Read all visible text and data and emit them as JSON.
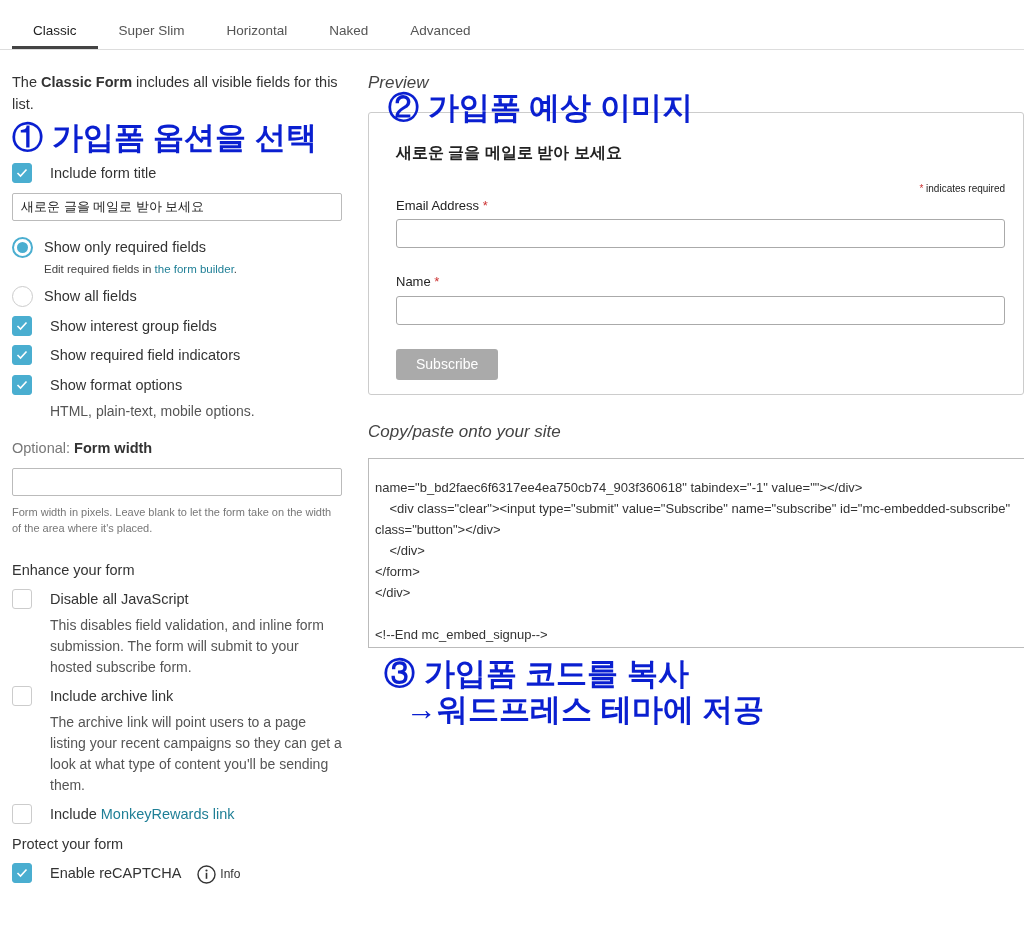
{
  "tabs": [
    {
      "label": "Classic",
      "selected": true
    },
    {
      "label": "Super Slim",
      "selected": false
    },
    {
      "label": "Horizontal",
      "selected": false
    },
    {
      "label": "Naked",
      "selected": false
    },
    {
      "label": "Advanced",
      "selected": false
    }
  ],
  "options": {
    "intro": "The **Classic Form** includes all visible fields for this list.",
    "annotation": "① 가입폼 옵션을 선택",
    "items": [
      {
        "kind": "checkbox",
        "label": "Include form title",
        "checked": true
      },
      {
        "kind": "field",
        "value": "새로운 글을 메일로 받아 보세요"
      },
      {
        "kind": "radio",
        "label": "Show only required fields",
        "selected": true,
        "note": "Edit required fields in",
        "note_link": "the form builder",
        "note_end": "."
      },
      {
        "kind": "radio",
        "label": "Show all fields",
        "selected": false
      },
      {
        "kind": "checkbox",
        "label": "Show interest group fields",
        "checked": true
      },
      {
        "kind": "checkbox",
        "label": "Show required field indicators",
        "checked": true
      },
      {
        "kind": "checkbox",
        "label": "Show format options",
        "checked": true,
        "description": "HTML, plain-text, mobile options."
      },
      {
        "kind": "width",
        "prefix": "Optional:",
        "label": "Form width",
        "hint": "Form width in pixels. Leave blank to let the form take on the width of the area where it's placed."
      },
      {
        "kind": "heading",
        "label": "Enhance your form"
      },
      {
        "kind": "checkbox",
        "label": "Disable all JavaScript",
        "checked": false,
        "description": "This disables field validation, and inline form submission. The form will submit to your hosted subscribe form."
      },
      {
        "kind": "checkbox",
        "label": "Include archive link",
        "checked": false,
        "description": "The archive link will point users to a page listing your recent campaigns so they can get a look at what type of content you'll be sending them."
      },
      {
        "kind": "checkbox",
        "label": "Include",
        "link": "MonkeyRewards link",
        "checked": false
      },
      {
        "kind": "heading",
        "label": "Protect your form"
      },
      {
        "kind": "checkbox",
        "label": "Enable reCAPTCHA",
        "checked": true,
        "info": "Info"
      }
    ]
  },
  "preview": {
    "heading": "Preview",
    "annotation": "② 가입폼 예상 이미지",
    "title": "새로운 글을 메일로 받아 보세요",
    "required_mark": "*",
    "required_note": "indicates required",
    "fields": [
      {
        "label": "Email Address",
        "mark": "*"
      },
      {
        "label": "Name",
        "mark": "*"
      }
    ],
    "button": "Subscribe"
  },
  "code": {
    "heading": "Copy/paste onto your site",
    "lines": [
      "name=\"b_bd2faec6f6317ee4ea750cb74_903f360618\" tabindex=\"-1\" value=\"\"></div>",
      "    <div class=\"clear\"><input type=\"submit\" value=\"Subscribe\" name=\"subscribe\" id=\"mc-embedded-subscribe\" class=\"button\"></div>",
      "    </div>",
      "</form>",
      "</div>",
      "<!--End mc_embed_signup-->"
    ],
    "annotation": [
      "③ 가입폼 코드를 복사",
      "→워드프레스 테마에 저공"
    ]
  }
}
